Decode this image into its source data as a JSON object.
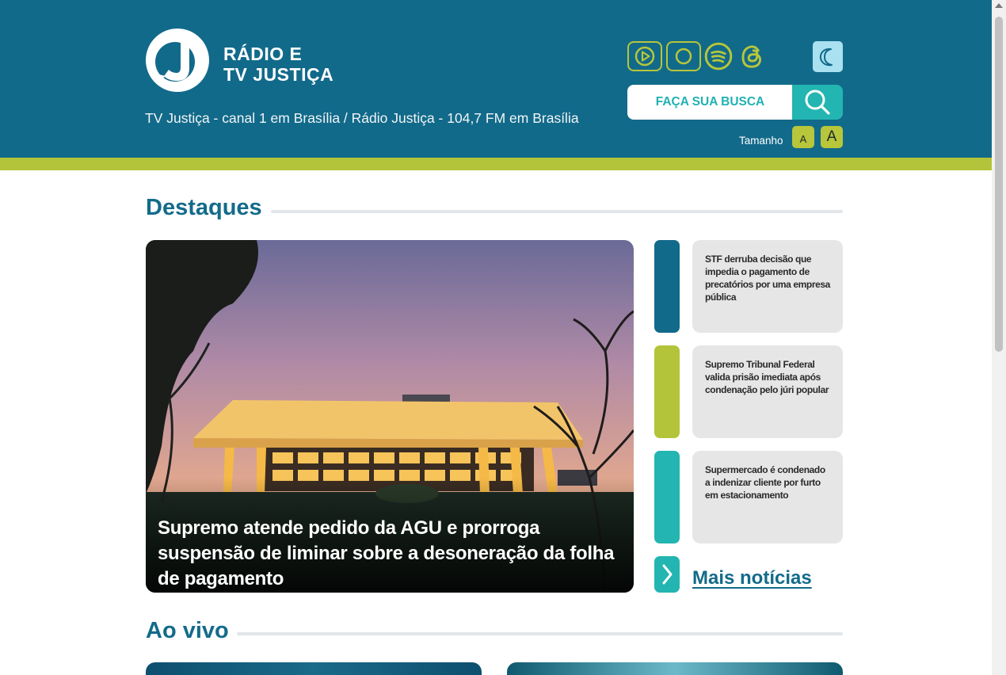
{
  "header": {
    "brand_line1": "RÁDIO E",
    "brand_line2": "TV JUSTIÇA",
    "tagline": "TV Justiça - canal 1 em Brasília / Rádio Justiça - 104,7 FM em Brasília",
    "social_icons": [
      "youtube-icon",
      "instagram-icon",
      "spotify-icon",
      "threads-icon"
    ],
    "dark_mode_icon": "moon-icon",
    "search_label": "FAÇA SUA BUSCA",
    "size_label": "Tamanho",
    "size_small": "A",
    "size_big": "A"
  },
  "colors": {
    "header_bg": "#126a8a",
    "accent_green": "#b3c43a",
    "accent_teal": "#23b5b1",
    "title_blue": "#136b8a"
  },
  "destaques": {
    "title": "Destaques",
    "featured_caption": "Supremo atende pedido da AGU e prorroga suspensão de liminar sobre a desoneração da folha de pagamento",
    "news": [
      {
        "text": "STF derruba decisão que impedia o pagamento de precatórios por uma empresa pública",
        "bar_color": "#126a8a"
      },
      {
        "text": "Supremo Tribunal Federal valida prisão imediata após condenação pelo júri popular",
        "bar_color": "#b3c43a"
      },
      {
        "text": "Supermercado é condenado a indenizar cliente por furto em estacionamento",
        "bar_color": "#23b5b1"
      }
    ],
    "more_label": "Mais notícias"
  },
  "ao_vivo": {
    "title": "Ao vivo"
  }
}
